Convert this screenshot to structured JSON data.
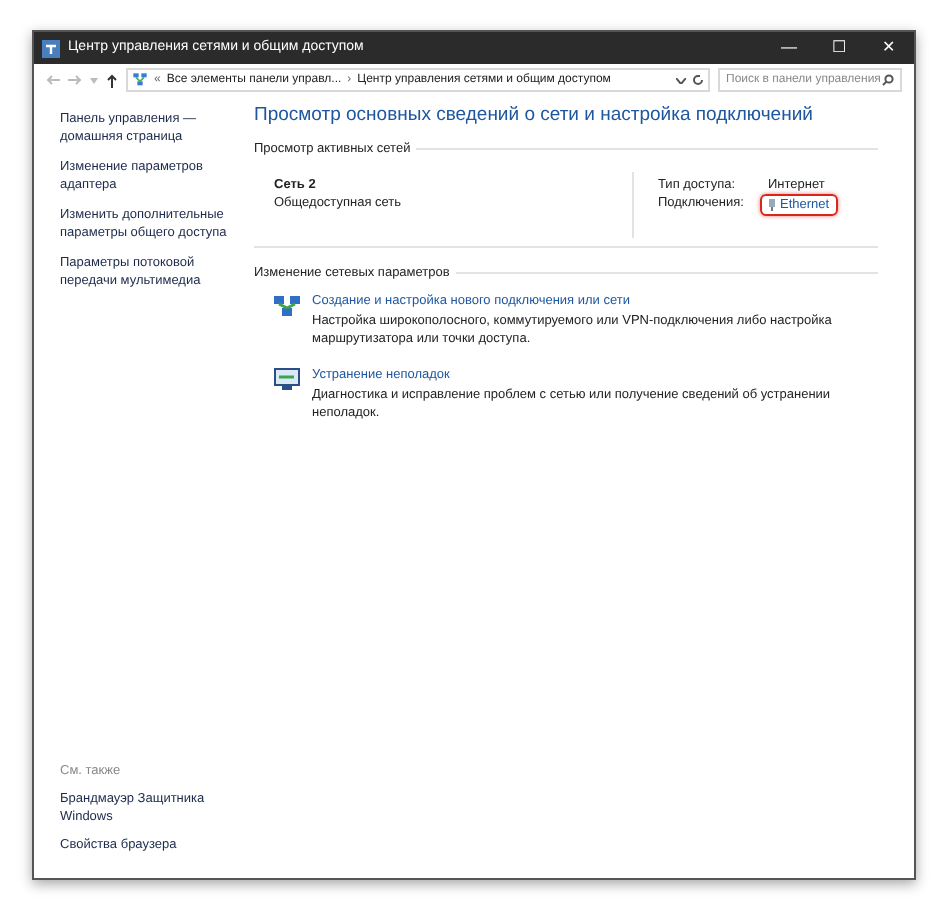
{
  "window": {
    "title": "Центр управления сетями и общим доступом",
    "controls": [
      "—",
      "☐",
      "✕"
    ]
  },
  "address_bar": {
    "overflow": "«",
    "crumbs": [
      "Все элементы панели управл...",
      "Центр управления сетями и общим доступом"
    ],
    "separator": "›"
  },
  "search": {
    "placeholder": "Поиск в панели управления"
  },
  "sidebar": {
    "items": [
      "Панель управления — домашняя страница",
      "Изменение параметров адаптера",
      "Изменить дополнительные параметры общего доступа",
      "Параметры потоковой передачи мультимедиа"
    ],
    "see_also": {
      "title": "См. также",
      "items": [
        "Брандмауэр Защитника Windows",
        "Свойства браузера"
      ]
    }
  },
  "main": {
    "heading": "Просмотр основных сведений о сети и настройка подключений",
    "active_networks": {
      "title": "Просмотр активных сетей",
      "name": "Сеть 2",
      "category": "Общедоступная сеть",
      "fields": [
        {
          "label": "Тип доступа:",
          "value": "Интернет",
          "kind": "text"
        },
        {
          "label": "Подключения:",
          "value": "Ethernet",
          "kind": "link",
          "highlighted": true
        }
      ]
    },
    "settings": {
      "title": "Изменение сетевых параметров",
      "tasks": [
        {
          "kind": "network",
          "link": "Создание и настройка нового подключения или сети",
          "description": "Настройка широкополосного, коммутируемого или VPN-подключения либо настройка маршрутизатора или точки доступа."
        },
        {
          "kind": "troubleshoot",
          "link": "Устранение неполадок",
          "description": "Диагностика и исправление проблем с сетью или получение сведений об устранении неполадок."
        }
      ]
    }
  }
}
